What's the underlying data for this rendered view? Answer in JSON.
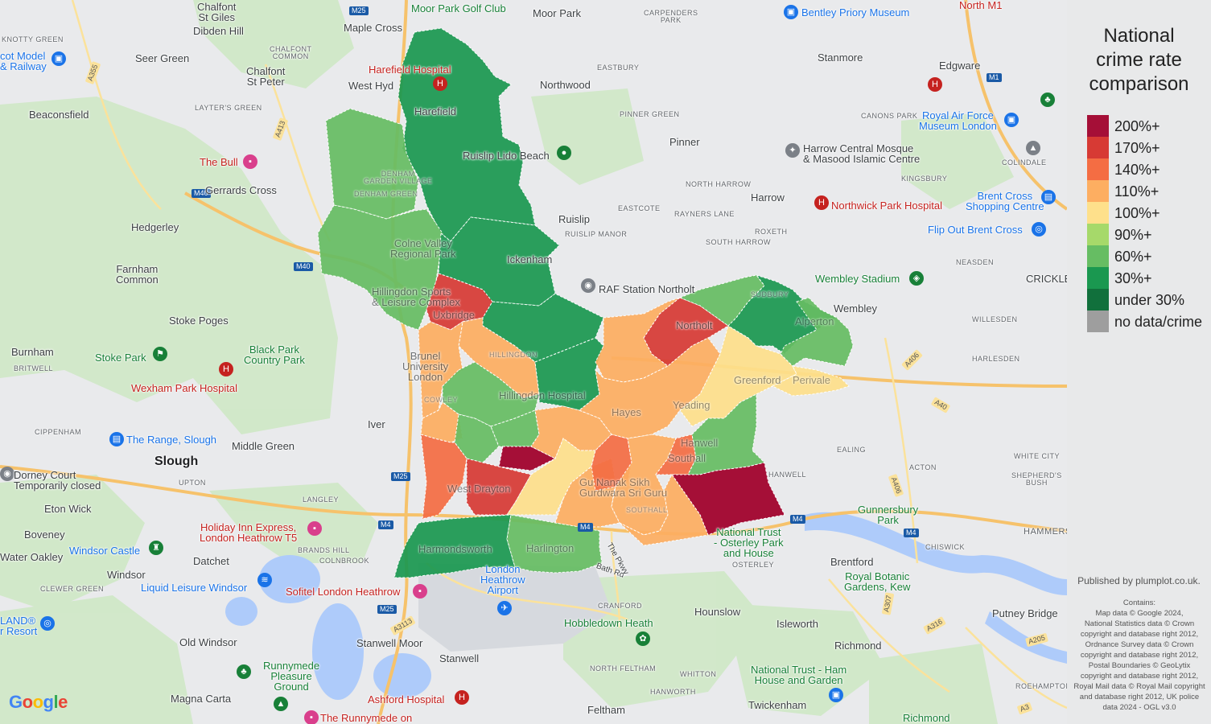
{
  "legend": {
    "title_lines": [
      "National",
      "crime rate",
      "comparison"
    ],
    "items": [
      {
        "label": "200%+",
        "color": "#a50f37"
      },
      {
        "label": "170%+",
        "color": "#d73a34"
      },
      {
        "label": "140%+",
        "color": "#f46d43"
      },
      {
        "label": "110%+",
        "color": "#fdae61"
      },
      {
        "label": "100%+",
        "color": "#fee08b"
      },
      {
        "label": "90%+",
        "color": "#a6d96a"
      },
      {
        "label": "60%+",
        "color": "#66bd63"
      },
      {
        "label": "30%+",
        "color": "#1a9850"
      },
      {
        "label": "under 30%",
        "color": "#11703c"
      },
      {
        "label": "no data/crime",
        "color": "#9e9e9e"
      }
    ]
  },
  "publisher": "Published by plumplot.co.uk.",
  "contains": "Contains:\nMap data © Google 2024,\nNational Statistics data © Crown copyright and database right 2012, Ordnance Survey data © Crown copyright and database right 2012, Postal Boundaries © GeoLytix copyright and database right 2012, Royal Mail data © Royal Mail copyright and database right 2012, UK police data 2024 - OGL v3.0",
  "google_logo": "Google",
  "map_labels": {
    "chalfont_st_giles": "Chalfont\nSt Giles",
    "knotty_green": "KNOTTY GREEN",
    "dibden_hill": "Dibden Hill",
    "maple_cross": "Maple Cross",
    "moor_park_golf": "Moor Park Golf Club",
    "moor_park": "Moor Park",
    "carpenders_park": "CARPENDERS\nPARK",
    "bentley_priory": "Bentley Priory Museum",
    "north_m1": "North M1",
    "cot_model": "cot Model\n& Railway",
    "seer_green": "Seer Green",
    "chalfont_common": "CHALFONT\nCOMMON",
    "chalfont_st_peter": "Chalfont\nSt Peter",
    "harefield_hospital": "Harefield Hospital",
    "west_hyde": "West Hyd",
    "northwood": "Northwood",
    "eastbury": "EASTBURY",
    "stanmore": "Stanmore",
    "edgware": "Edgware",
    "beaconsfield": "Beaconsfield",
    "layters_green": "LAYTER'S GREEN",
    "harefield": "Harefield",
    "pinner_green": "PINNER GREEN",
    "canons_park": "CANONS PARK",
    "raf_museum": "Royal Air Force\nMuseum London",
    "the_bull": "The Bull",
    "ruislip_beach": "Ruislip Lido Beach",
    "pinner": "Pinner",
    "harrow_mosque": "Harrow Central Mosque\n& Masood Islamic Centre",
    "kingsbury": "KINGSBURY",
    "colindale": "COLINDALE",
    "gerrards_cross": "Gerrards Cross",
    "denham_garden_village": "DENHAM\nGARDEN VILLAGE",
    "denham_green": "DENHAM GREEN",
    "north_harrow": "NORTH HARROW",
    "harrow": "Harrow",
    "hedgerley": "Hedgerley",
    "ruislip": "Ruislip",
    "eastcote": "EASTCOTE",
    "rayners_lane": "RAYNERS LANE",
    "roxeth": "ROXETH",
    "northwick_park": "Northwick Park Hospital",
    "brent_cross": "Brent Cross\nShopping Centre",
    "ruislip_manor": "RUISLIP MANOR",
    "south_harrow": "SOUTH HARROW",
    "flip_out": "Flip Out Brent Cross",
    "farnham_common": "Farnham\nCommon",
    "colne_valley": "Colne Valley\nRegional Park",
    "ickenham": "Ickenham",
    "neasden": "NEASDEN",
    "raf_northolt": "RAF Station Northolt",
    "wembley_stadium": "Wembley Stadium",
    "crickle": "CRICKLE",
    "hillingdon_leisure": "Hillingdon Sports\n& Leisure Complex",
    "uxbridge": "Uxbridge",
    "northolt": "Northolt",
    "sudbury": "SUDBURY",
    "wembley": "Wembley",
    "stoke_poges": "Stoke Poges",
    "willesden": "WILLESDEN",
    "burnham": "Burnham",
    "stoke_park": "Stoke Park",
    "black_park": "Black Park\nCountry Park",
    "brunel": "Brunel\nUniversity\nLondon",
    "hillingdon": "HILLINGDON",
    "alperton": "Alperton",
    "harlesden": "HARLESDEN",
    "britwell": "BRITWELL",
    "wexham_park": "Wexham Park Hospital",
    "hillingdon_hospital": "Hillingdon Hospital",
    "greenford": "Greenford",
    "perivale": "Perivale",
    "cippenham": "CIPPENHAM",
    "the_range": "The Range, Slough",
    "iver": "Iver",
    "yeading": "Yeading",
    "cowley": "COWLEY",
    "ealing": "EALING",
    "middle_green": "Middle Green",
    "slough": "Slough",
    "hayes": "Hayes",
    "hanwell": "Hanwell",
    "acton": "ACTON",
    "white_city": "WHITE CITY",
    "dorney_court": "Dorney Court\nTemporarily closed",
    "upton": "UPTON",
    "langley": "LANGLEY",
    "west_drayton": "West Drayton",
    "southall": "Southall",
    "hanwell_town": "HANWELL",
    "shepherds_bush": "SHEPHERD'S\nBUSH",
    "eton_wick": "Eton Wick",
    "sikh_temple": "Gu Nanak Sikh\nGurdwara Sri Guru",
    "southall_broadway": "SOUTHALL",
    "gunnersbury": "Gunnersbury\nPark",
    "boveney": "Boveney",
    "holiday_inn": "Holiday Inn Express,\nLondon Heathrow T5",
    "osterley_park": "National Trust\n- Osterley Park\nand House",
    "hammersmith": "HAMMERSM",
    "windsor_castle": "Windsor Castle",
    "datchet": "Datchet",
    "brands_hill": "BRANDS HILL",
    "colnbrook": "COLNBROOK",
    "harmondsworth": "Harmondsworth",
    "harlington": "Harlington",
    "water_oakley": "Water Oakley",
    "london_heathrow": "London\nHeathrow\nAirport",
    "bath_rd": "Bath Rd",
    "brentford": "Brentford",
    "chiswick": "CHISWICK",
    "windsor": "Windsor",
    "osterley": "OSTERLEY",
    "kew": "Royal Botanic\nGardens, Kew",
    "clewer_green": "CLEWER GREEN",
    "liquid_leisure": "Liquid Leisure Windsor",
    "sofitel": "Sofitel London Heathrow",
    "cranford": "CRANFORD",
    "hounslow": "Hounslow",
    "isleworth": "Isleworth",
    "putney_bridge": "Putney Bridge",
    "legoland": "LAND®\nr Resort",
    "hobbledown": "Hobbledown Heath",
    "richmond": "Richmond",
    "old_windsor": "Old Windsor",
    "stanwell_moor": "Stanwell Moor",
    "stanwell": "Stanwell",
    "north_feltham": "NORTH FELTHAM",
    "whitton": "WHITTON",
    "ham_house": "National Trust - Ham\nHouse and Garden",
    "runnymede": "Runnymede\nPleasure\nGround",
    "hanworth": "HANWORTH",
    "roehampton": "ROEHAMPTON",
    "magna_carta": "Magna Carta",
    "ashford_hospital": "Ashford Hospital",
    "feltham": "Feltham",
    "twickenham": "Twickenham",
    "runnymede_on": "The Runnymede on",
    "richmond_park": "Richmond",
    "the_pkwy": "The Pkwy"
  },
  "road_shields": {
    "m25_top": "M25",
    "a355": "A355",
    "a413": "A413",
    "m40_a": "M40",
    "m40_b": "M40",
    "m25_mid": "M25",
    "m4_a": "M4",
    "m4_b": "M4",
    "m4_c": "M4",
    "m4_d": "M4",
    "m25_low": "M25",
    "a3113": "A3113",
    "m1": "M1",
    "a406": "A406",
    "a40": "A40",
    "a406b": "A406",
    "a307": "A307",
    "a316": "A316",
    "a205": "A205",
    "a3": "A3"
  }
}
